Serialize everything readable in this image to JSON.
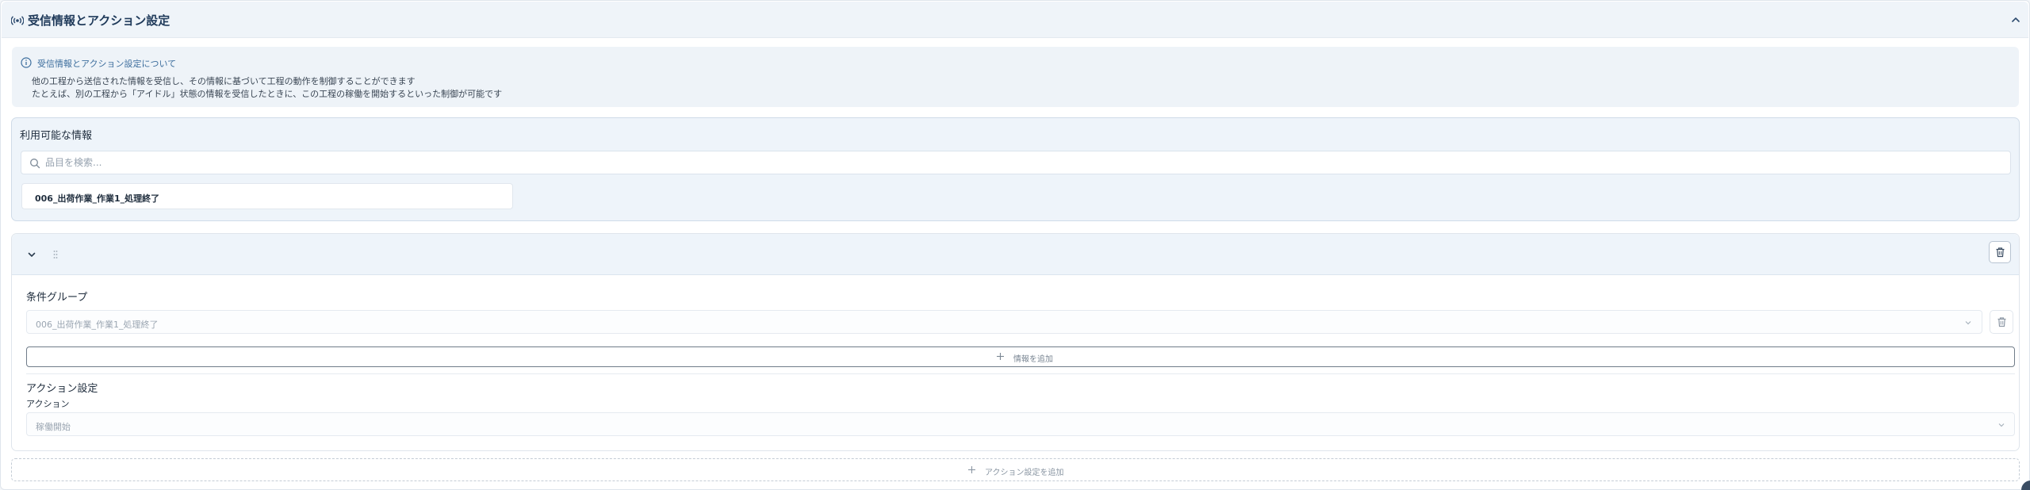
{
  "panel": {
    "title": "受信情報とアクション設定"
  },
  "info": {
    "title": "受信情報とアクション設定について",
    "line1": "他の工程から送信された情報を受信し、その情報に基づいて工程の動作を制御することができます",
    "line2": "たとえば、別の工程から「アイドル」状態の情報を受信したときに、この工程の稼働を開始するといった制御が可能です"
  },
  "available": {
    "title": "利用可能な情報",
    "search_placeholder": "品目を検索...",
    "items": [
      {
        "label": "006_出荷作業_作業1_処理終了"
      }
    ]
  },
  "rule_card": {
    "condition_group": {
      "title": "条件グループ",
      "selected": "006_出荷作業_作業1_処理終了",
      "add_info_label": "情報を追加"
    },
    "action": {
      "section_title": "アクション設定",
      "field_label": "アクション",
      "selected": "稼働開始"
    }
  },
  "add_action_label": "アクション設定を追加",
  "icons": {
    "header": "broadcast-icon",
    "collapse": "chevron-up-icon",
    "info": "info-circle-icon",
    "search": "search-icon",
    "expand": "chevron-down-icon",
    "drag": "drag-handle-icon",
    "delete": "trash-icon",
    "add": "plus-icon"
  },
  "colors": {
    "accent": "#1f3a5a",
    "info_title": "#3e6f9e",
    "panel_bg": "#eef4fa"
  }
}
